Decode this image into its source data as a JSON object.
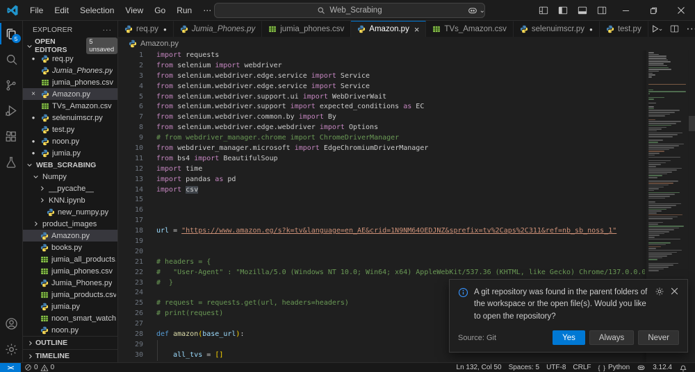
{
  "titlebar": {
    "menus": [
      "File",
      "Edit",
      "Selection",
      "View",
      "Go",
      "Run",
      "⋯"
    ],
    "search_value": "Web_Scrabing"
  },
  "activity_bar": {
    "badge": "5",
    "items": [
      {
        "id": "explorer",
        "active": true
      },
      {
        "id": "search"
      },
      {
        "id": "source-control"
      },
      {
        "id": "run-debug"
      },
      {
        "id": "extensions"
      },
      {
        "id": "testing"
      }
    ],
    "bottom": [
      {
        "id": "account"
      },
      {
        "id": "settings"
      }
    ]
  },
  "sidebar": {
    "title": "EXPLORER",
    "open_editors": {
      "label": "OPEN EDITORS",
      "badge": "5 unsaved",
      "items": [
        {
          "label": "req.py",
          "icon": "python",
          "modified": true
        },
        {
          "label": "Jumia_Phones.py",
          "icon": "python",
          "preview": true
        },
        {
          "label": "jumia_phones.csv",
          "icon": "csv"
        },
        {
          "label": "Amazon.py",
          "icon": "python",
          "selected": true,
          "close": true
        },
        {
          "label": "TVs_Amazon.csv",
          "icon": "csv"
        },
        {
          "label": "selenuimscr.py",
          "icon": "python",
          "modified": true
        },
        {
          "label": "test.py",
          "icon": "python"
        },
        {
          "label": "noon.py",
          "icon": "python",
          "modified": true
        },
        {
          "label": "jumia.py",
          "icon": "python",
          "modified": true
        }
      ]
    },
    "tree": [
      {
        "label": "WEB_SCRABING",
        "chevron": "down",
        "indent": 0,
        "bold": true
      },
      {
        "label": "Numpy",
        "chevron": "down",
        "indent": 1
      },
      {
        "label": "__pycache__",
        "chevron": "right",
        "indent": 2
      },
      {
        "label": "KNN.ipynb",
        "chevron": "right",
        "indent": 2
      },
      {
        "label": "new_numpy.py",
        "icon": "python",
        "indent": 2
      },
      {
        "label": "product_images",
        "chevron": "right",
        "indent": 1
      },
      {
        "label": "Amazon.py",
        "icon": "python",
        "indent": 1,
        "selected": true
      },
      {
        "label": "books.py",
        "icon": "python",
        "indent": 1
      },
      {
        "label": "jumia_all_products.csv",
        "icon": "csv",
        "indent": 1
      },
      {
        "label": "jumia_phones.csv",
        "icon": "csv",
        "indent": 1
      },
      {
        "label": "Jumia_Phones.py",
        "icon": "python",
        "indent": 1
      },
      {
        "label": "jumia_products.csv",
        "icon": "csv",
        "indent": 1
      },
      {
        "label": "jumia.py",
        "icon": "python",
        "indent": 1
      },
      {
        "label": "noon_smart_watch.csv",
        "icon": "csv",
        "indent": 1
      },
      {
        "label": "noon.py",
        "icon": "python",
        "indent": 1
      }
    ],
    "sections": [
      "OUTLINE",
      "TIMELINE"
    ]
  },
  "tabs": [
    {
      "label": "req.py",
      "icon": "python",
      "modified": true
    },
    {
      "label": "Jumia_Phones.py",
      "icon": "python",
      "preview": true
    },
    {
      "label": "jumia_phones.csv",
      "icon": "csv"
    },
    {
      "label": "Amazon.py",
      "icon": "python",
      "active": true,
      "close": true
    },
    {
      "label": "TVs_Amazon.csv",
      "icon": "csv"
    },
    {
      "label": "selenuimscr.py",
      "icon": "python",
      "modified": true
    },
    {
      "label": "test.py",
      "icon": "python"
    }
  ],
  "breadcrumb": {
    "file": "Amazon.py"
  },
  "editor": {
    "lines": [
      {
        "n": 1,
        "s": [
          [
            "kw",
            "import"
          ],
          [
            "pl",
            " requests"
          ]
        ]
      },
      {
        "n": 2,
        "s": [
          [
            "kw",
            "from"
          ],
          [
            "pl",
            " selenium "
          ],
          [
            "kw",
            "import"
          ],
          [
            "pl",
            " webdriver"
          ]
        ]
      },
      {
        "n": 3,
        "s": [
          [
            "kw",
            "from"
          ],
          [
            "pl",
            " selenium.webdriver.edge.service "
          ],
          [
            "kw",
            "import"
          ],
          [
            "pl",
            " Service"
          ]
        ]
      },
      {
        "n": 4,
        "s": [
          [
            "kw",
            "from"
          ],
          [
            "pl",
            " selenium.webdriver.edge.service "
          ],
          [
            "kw",
            "import"
          ],
          [
            "pl",
            " Service"
          ]
        ]
      },
      {
        "n": 5,
        "s": [
          [
            "kw",
            "from"
          ],
          [
            "pl",
            " selenium.webdriver.support.ui "
          ],
          [
            "kw",
            "import"
          ],
          [
            "pl",
            " WebDriverWait"
          ]
        ]
      },
      {
        "n": 6,
        "s": [
          [
            "kw",
            "from"
          ],
          [
            "pl",
            " selenium.webdriver.support "
          ],
          [
            "kw",
            "import"
          ],
          [
            "pl",
            " expected_conditions "
          ],
          [
            "kw",
            "as"
          ],
          [
            "pl",
            " EC"
          ]
        ]
      },
      {
        "n": 7,
        "s": [
          [
            "kw",
            "from"
          ],
          [
            "pl",
            " selenium.webdriver.common.by "
          ],
          [
            "kw",
            "import"
          ],
          [
            "pl",
            " By"
          ]
        ]
      },
      {
        "n": 8,
        "s": [
          [
            "kw",
            "from"
          ],
          [
            "pl",
            " selenium.webdriver.edge.webdriver "
          ],
          [
            "kw",
            "import"
          ],
          [
            "pl",
            " Options"
          ]
        ]
      },
      {
        "n": 9,
        "s": [
          [
            "cm",
            "# from webdriver_manager.chrome import ChromeDriverManager"
          ]
        ]
      },
      {
        "n": 10,
        "s": [
          [
            "kw",
            "from"
          ],
          [
            "pl",
            " webdriver_manager.microsoft "
          ],
          [
            "kw",
            "import"
          ],
          [
            "pl",
            " EdgeChromiumDriverManager"
          ]
        ]
      },
      {
        "n": 11,
        "s": [
          [
            "kw",
            "from"
          ],
          [
            "pl",
            " bs4 "
          ],
          [
            "kw",
            "import"
          ],
          [
            "pl",
            " BeautifulSoup"
          ]
        ]
      },
      {
        "n": 12,
        "s": [
          [
            "kw",
            "import"
          ],
          [
            "pl",
            " time"
          ]
        ]
      },
      {
        "n": 13,
        "s": [
          [
            "kw",
            "import"
          ],
          [
            "pl",
            " pandas "
          ],
          [
            "kw",
            "as"
          ],
          [
            "pl",
            " pd"
          ]
        ]
      },
      {
        "n": 14,
        "s": [
          [
            "kw",
            "import"
          ],
          [
            "pl",
            " "
          ],
          [
            "hl",
            "csv"
          ]
        ]
      },
      {
        "n": 15
      },
      {
        "n": 16
      },
      {
        "n": 17
      },
      {
        "n": 18,
        "s": [
          [
            "vr",
            "url"
          ],
          [
            "pl",
            " = "
          ],
          [
            "lk",
            "\"https://www.amazon.eg/s?k=tv&language=en_AE&crid=1N9NM64OEDJNZ&sprefix=tv%2Caps%2C311&ref=nb_sb_noss_1\""
          ]
        ]
      },
      {
        "n": 19
      },
      {
        "n": 20
      },
      {
        "n": 21,
        "s": [
          [
            "cm",
            "# headers = {"
          ]
        ]
      },
      {
        "n": 22,
        "s": [
          [
            "cm",
            "#   \"User-Agent\" : \"Mozilla/5.0 (Windows NT 10.0; Win64; x64) AppleWebKit/537.36 (KHTML, like Gecko) Chrome/137.0.0.0"
          ]
        ]
      },
      {
        "n": 23,
        "s": [
          [
            "cm",
            "#  }"
          ]
        ]
      },
      {
        "n": 24
      },
      {
        "n": 25,
        "s": [
          [
            "cm",
            "# request = requests.get(url, headers=headers)"
          ]
        ]
      },
      {
        "n": 26,
        "s": [
          [
            "cm",
            "# print(request)"
          ]
        ]
      },
      {
        "n": 27
      },
      {
        "n": 28,
        "s": [
          [
            "ct",
            "def"
          ],
          [
            "pl",
            " "
          ],
          [
            "fn",
            "amazon"
          ],
          [
            "bk",
            "("
          ],
          [
            "vr",
            "base_url"
          ],
          [
            "bk",
            ")"
          ],
          [
            "pl",
            ":"
          ]
        ]
      },
      {
        "n": 29,
        "guide": true
      },
      {
        "n": 30,
        "guide": true,
        "s": [
          [
            "pl",
            "    "
          ],
          [
            "vr",
            "all_tvs"
          ],
          [
            "pl",
            " = "
          ],
          [
            "bk",
            "[]"
          ]
        ]
      }
    ]
  },
  "notification": {
    "message": "A git repository was found in the parent folders of the workspace or the open file(s). Would you like to open the repository?",
    "source": "Source: Git",
    "buttons": [
      {
        "label": "Yes",
        "primary": true
      },
      {
        "label": "Always"
      },
      {
        "label": "Never"
      }
    ]
  },
  "status_bar": {
    "errors": "0",
    "warnings": "0",
    "right": [
      {
        "name": "cursor-position",
        "label": "Ln 132, Col 50"
      },
      {
        "name": "indentation",
        "label": "Spaces: 5"
      },
      {
        "name": "encoding",
        "label": "UTF-8"
      },
      {
        "name": "eol",
        "label": "CRLF"
      },
      {
        "name": "language-mode",
        "label": "Python",
        "icon": "braces"
      },
      {
        "name": "copilot-status",
        "label": "",
        "icon": "copilot"
      },
      {
        "name": "python-interpreter",
        "label": "3.12.4"
      },
      {
        "name": "notifications-bell",
        "label": "",
        "icon": "bell"
      }
    ]
  },
  "colors": {
    "accent": "#0078d4",
    "keyword": "#c586c0",
    "comment": "#6a9955",
    "string": "#ce9178",
    "variable": "#9cdcfe",
    "function": "#dcdcaa",
    "control": "#569cd6",
    "bracket": "#ffd700",
    "editor_bg": "#1f1f1f",
    "chrome_bg": "#181818"
  }
}
